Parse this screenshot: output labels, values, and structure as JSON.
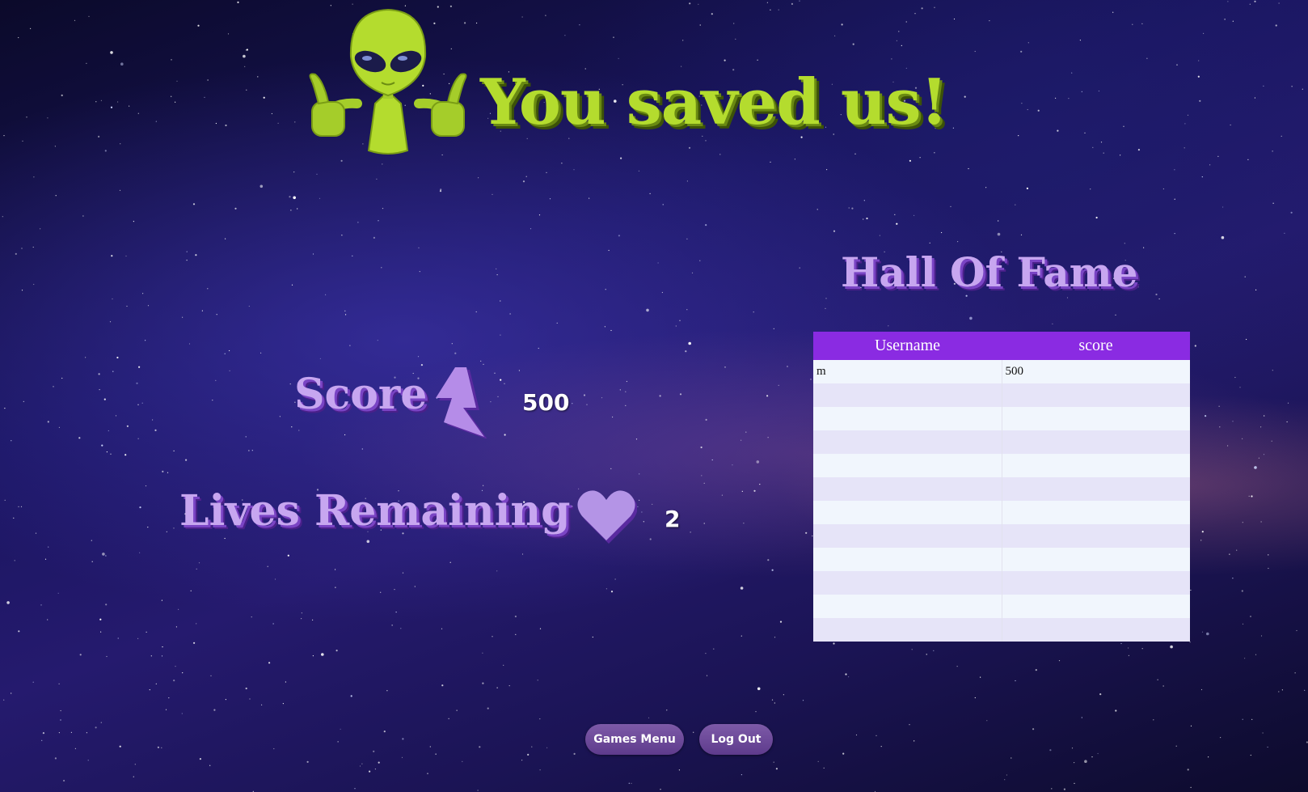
{
  "title": {
    "text": "You saved us!"
  },
  "stats": {
    "score_label": "Score",
    "score_value": "500",
    "lives_label": "Lives Remaining",
    "lives_value": "2"
  },
  "hall_of_fame": {
    "title": "Hall Of Fame",
    "columns": [
      "Username",
      "score"
    ],
    "rows": [
      [
        "m",
        "500"
      ],
      [
        "",
        ""
      ],
      [
        "",
        ""
      ],
      [
        "",
        ""
      ],
      [
        "",
        ""
      ],
      [
        "",
        ""
      ],
      [
        "",
        ""
      ],
      [
        "",
        ""
      ],
      [
        "",
        ""
      ],
      [
        "",
        ""
      ],
      [
        "",
        ""
      ],
      [
        "",
        ""
      ]
    ]
  },
  "buttons": {
    "games_menu": "Games Menu",
    "log_out": "Log Out"
  },
  "icons": {
    "alien": "alien-thumbs-up-icon",
    "score": "lightning-bolt-icon",
    "lives": "heart-icon"
  },
  "colors": {
    "title": "#b4dc2e",
    "label": "#c7a6f0",
    "table_header": "#8a2be2",
    "button": "#6a4696"
  }
}
